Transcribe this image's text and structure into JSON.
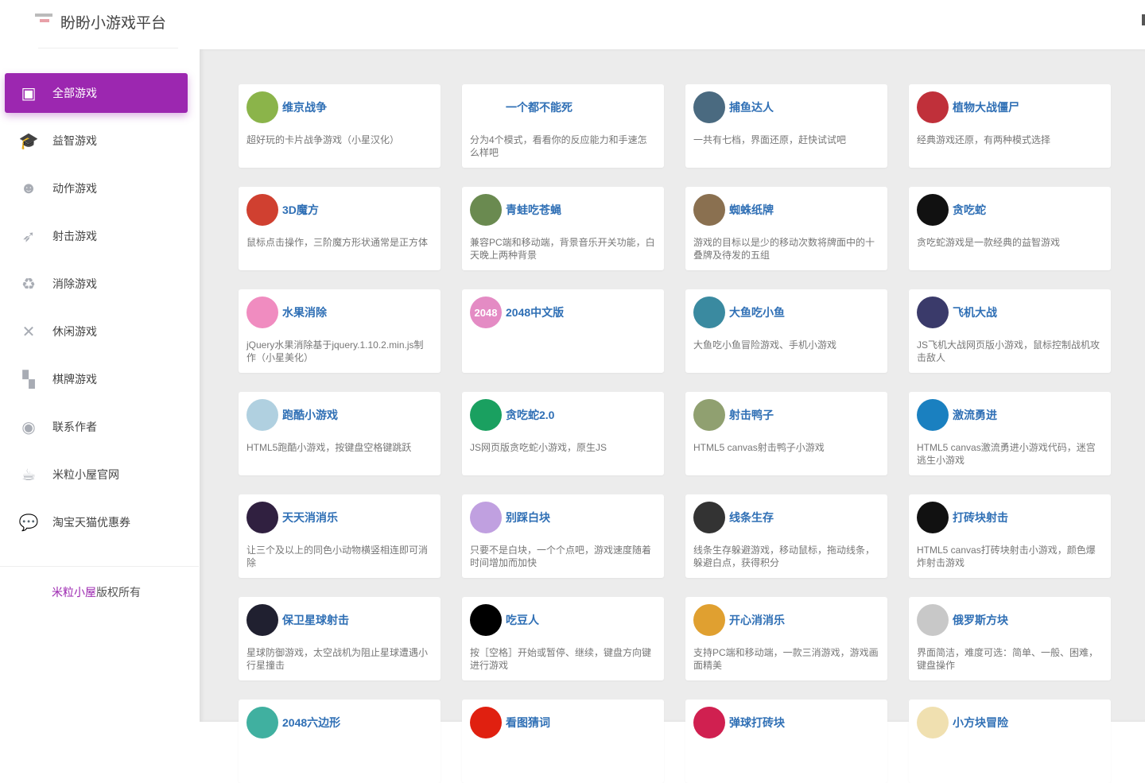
{
  "header": {
    "title": "盼盼小游戏平台"
  },
  "sidebar": {
    "items": [
      {
        "label": "全部游戏",
        "icon": "twitch-icon",
        "glyph": "▣",
        "active": true
      },
      {
        "label": "益智游戏",
        "icon": "graduation-cap-icon",
        "glyph": "🎓"
      },
      {
        "label": "动作游戏",
        "icon": "reddit-icon",
        "glyph": "☻"
      },
      {
        "label": "射击游戏",
        "icon": "rocket-icon",
        "glyph": "➶"
      },
      {
        "label": "消除游戏",
        "icon": "cycle-icon",
        "glyph": "♻"
      },
      {
        "label": "休闲游戏",
        "icon": "pinwheel-icon",
        "glyph": "✕"
      },
      {
        "label": "棋牌游戏",
        "icon": "checkerboard-icon",
        "glyph": "▚"
      },
      {
        "label": "联系作者",
        "icon": "user-circle-icon",
        "glyph": "◉"
      },
      {
        "label": "米粒小屋官网",
        "icon": "coffee-cup-icon",
        "glyph": "☕"
      },
      {
        "label": "淘宝天猫优惠券",
        "icon": "chat-bubble-icon",
        "glyph": "💬"
      }
    ],
    "copyright_highlight": "米粒小屋",
    "copyright_rest": "版权所有"
  },
  "games": [
    {
      "title": "维京战争",
      "desc": "超好玩的卡片战争游戏（小星汉化）",
      "color": "#8bb44a"
    },
    {
      "title": "一个都不能死",
      "desc": "分为4个模式，看看你的反应能力和手速怎么样吧",
      "color": "#ffffff"
    },
    {
      "title": "捕鱼达人",
      "desc": "一共有七档，界面还原，赶快试试吧",
      "color": "#4a6a80"
    },
    {
      "title": "植物大战僵尸",
      "desc": "经典游戏还原，有两种模式选择",
      "color": "#c0303a"
    },
    {
      "title": "3D魔方",
      "desc": "鼠标点击操作，三阶魔方形状通常是正方体",
      "color": "#d04030"
    },
    {
      "title": "青蛙吃苍蝇",
      "desc": "兼容PC端和移动端，背景音乐开关功能，白天晚上两种背景",
      "color": "#6a8a50"
    },
    {
      "title": "蜘蛛纸牌",
      "desc": "游戏的目标以是少的移动次数将牌面中的十叠牌及待发的五组",
      "color": "#8a7050"
    },
    {
      "title": "贪吃蛇",
      "desc": "贪吃蛇游戏是一款经典的益智游戏",
      "color": "#111111"
    },
    {
      "title": "水果消除",
      "desc": "jQuery水果消除基于jquery.1.10.2.min.js制作（小星美化）",
      "color": "#f08cc0"
    },
    {
      "title": "2048中文版",
      "desc": "",
      "color": "#e48bc4",
      "badge": "2048"
    },
    {
      "title": "大鱼吃小鱼",
      "desc": "大鱼吃小鱼冒险游戏、手机小游戏",
      "color": "#3a8aa0"
    },
    {
      "title": "飞机大战",
      "desc": "JS飞机大战网页版小游戏，鼠标控制战机攻击敌人",
      "color": "#3a3a6a"
    },
    {
      "title": "跑酷小游戏",
      "desc": "HTML5跑酷小游戏，按键盘空格键跳跃",
      "color": "#b0d0e0"
    },
    {
      "title": "贪吃蛇2.0",
      "desc": "JS网页版贪吃蛇小游戏，原生JS",
      "color": "#1aa060"
    },
    {
      "title": "射击鸭子",
      "desc": "HTML5 canvas射击鸭子小游戏",
      "color": "#90a070"
    },
    {
      "title": "激流勇进",
      "desc": "HTML5 canvas激流勇进小游戏代码，迷宫逃生小游戏",
      "color": "#1a80c0"
    },
    {
      "title": "天天消消乐",
      "desc": "让三个及以上的同色小动物横竖相连即可消除",
      "color": "#302040"
    },
    {
      "title": "别踩白块",
      "desc": "只要不是白块，一个个点吧，游戏速度随着时间增加而加快",
      "color": "#c0a0e0"
    },
    {
      "title": "线条生存",
      "desc": "线条生存躲避游戏，移动鼠标，拖动线条，躲避白点，获得积分",
      "color": "#333333"
    },
    {
      "title": "打砖块射击",
      "desc": "HTML5 canvas打砖块射击小游戏，颜色爆炸射击游戏",
      "color": "#111111"
    },
    {
      "title": "保卫星球射击",
      "desc": "星球防御游戏，太空战机为阻止星球遭遇小行星撞击",
      "color": "#202030"
    },
    {
      "title": "吃豆人",
      "desc": "按［空格］开始或暂停、继续，键盘方向键进行游戏",
      "color": "#000000"
    },
    {
      "title": "开心消消乐",
      "desc": "支持PC端和移动端，一款三消游戏，游戏画面精美",
      "color": "#e0a030"
    },
    {
      "title": "俄罗斯方块",
      "desc": "界面简洁，难度可选：简单、一般、困难，键盘操作",
      "color": "#c8c8c8"
    },
    {
      "title": "2048六边形",
      "desc": "",
      "color": "#40b0a0"
    },
    {
      "title": "看图猜词",
      "desc": "",
      "color": "#e02010"
    },
    {
      "title": "弹球打砖块",
      "desc": "",
      "color": "#d02050"
    },
    {
      "title": "小方块冒险",
      "desc": "",
      "color": "#f0e0b0"
    }
  ]
}
